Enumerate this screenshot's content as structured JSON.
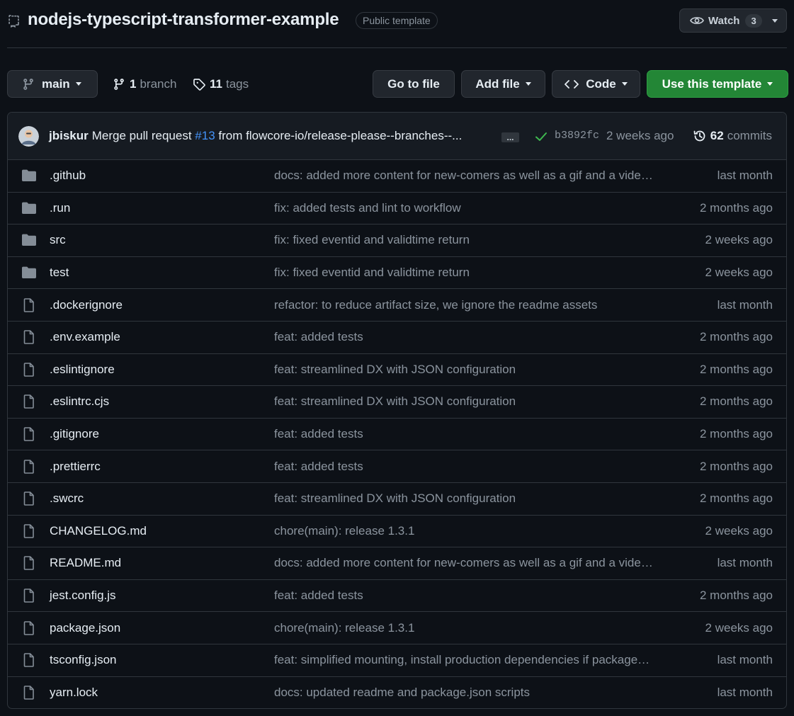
{
  "repo": {
    "name": "nodejs-typescript-transformer-example",
    "visibility_badge": "Public template",
    "watch_label": "Watch",
    "watch_count": "3"
  },
  "toolbar": {
    "branch": "main",
    "branches_count": "1",
    "branches_label": "branch",
    "tags_count": "11",
    "tags_label": "tags",
    "go_to_file": "Go to file",
    "add_file": "Add file",
    "code": "Code",
    "use_template": "Use this template"
  },
  "latest_commit": {
    "author": "jbiskur",
    "message_prefix": "Merge pull request",
    "pr": "#13",
    "message_suffix": "from flowcore-io/release-please--branches--...",
    "ellipsis": "...",
    "sha": "b3892fc",
    "time": "2 weeks ago",
    "commits_count": "62",
    "commits_label": "commits"
  },
  "files": [
    {
      "type": "folder",
      "name": ".github",
      "commit": "docs: added more content for new-comers as well as a gif and a vide…",
      "age": "last month"
    },
    {
      "type": "folder",
      "name": ".run",
      "commit": "fix: added tests and lint to workflow",
      "age": "2 months ago"
    },
    {
      "type": "folder",
      "name": "src",
      "commit": "fix: fixed eventid and validtime return",
      "age": "2 weeks ago"
    },
    {
      "type": "folder",
      "name": "test",
      "commit": "fix: fixed eventid and validtime return",
      "age": "2 weeks ago"
    },
    {
      "type": "file",
      "name": ".dockerignore",
      "commit": "refactor: to reduce artifact size, we ignore the readme assets",
      "age": "last month"
    },
    {
      "type": "file",
      "name": ".env.example",
      "commit": "feat: added tests",
      "age": "2 months ago"
    },
    {
      "type": "file",
      "name": ".eslintignore",
      "commit": "feat: streamlined DX with JSON configuration",
      "age": "2 months ago"
    },
    {
      "type": "file",
      "name": ".eslintrc.cjs",
      "commit": "feat: streamlined DX with JSON configuration",
      "age": "2 months ago"
    },
    {
      "type": "file",
      "name": ".gitignore",
      "commit": "feat: added tests",
      "age": "2 months ago"
    },
    {
      "type": "file",
      "name": ".prettierrc",
      "commit": "feat: added tests",
      "age": "2 months ago"
    },
    {
      "type": "file",
      "name": ".swcrc",
      "commit": "feat: streamlined DX with JSON configuration",
      "age": "2 months ago"
    },
    {
      "type": "file",
      "name": "CHANGELOG.md",
      "commit": "chore(main): release 1.3.1",
      "age": "2 weeks ago"
    },
    {
      "type": "file",
      "name": "README.md",
      "commit": "docs: added more content for new-comers as well as a gif and a vide…",
      "age": "last month"
    },
    {
      "type": "file",
      "name": "jest.config.js",
      "commit": "feat: added tests",
      "age": "2 months ago"
    },
    {
      "type": "file",
      "name": "package.json",
      "commit": "chore(main): release 1.3.1",
      "age": "2 weeks ago"
    },
    {
      "type": "file",
      "name": "tsconfig.json",
      "commit": "feat: simplified mounting, install production dependencies if package…",
      "age": "last month"
    },
    {
      "type": "file",
      "name": "yarn.lock",
      "commit": "docs: updated readme and package.json scripts",
      "age": "last month"
    }
  ],
  "colors": {
    "background": "#0d1117",
    "accent_green": "#238636",
    "link_blue": "#4493f8",
    "muted_text": "#8b949e"
  }
}
